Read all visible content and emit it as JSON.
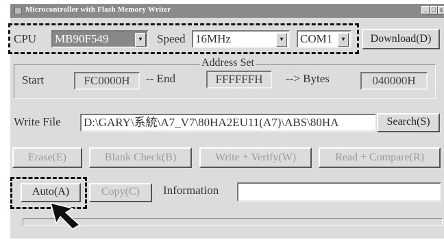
{
  "window": {
    "title": "Microcontroller with Flash Memory Writer",
    "minimize_glyph": "_",
    "maximize_glyph": "□",
    "close_glyph": "x"
  },
  "cpu": {
    "label": "CPU",
    "value": "MB90F549"
  },
  "speed": {
    "label": "Speed",
    "value": "16MHz"
  },
  "port": {
    "value": "COM1"
  },
  "download_button": "Download(D)",
  "address_set": {
    "group_title": "Address Set",
    "start_label": "Start",
    "start_value": "FC0000H",
    "end_label": "-- End",
    "end_value": "FFFFFFH",
    "bytes_label": "--> Bytes",
    "bytes_value": "040000H"
  },
  "write_file": {
    "label": "Write File",
    "value": "D:\\GARY\\系統\\A7_V7\\80HA2EU11(A7)\\ABS\\80HA",
    "search_button": "Search(S)"
  },
  "operations": {
    "erase": "Erase(E)",
    "blank_check": "Blank Check(B)",
    "write_verify": "Write + Verify(W)",
    "read_compare": "Read + Compare(R)"
  },
  "auto_button": "Auto(A)",
  "copy_button": "Copy(C)",
  "information": {
    "label": "Information",
    "value": ""
  },
  "progress": {
    "fraction": 0
  },
  "icons": {
    "pointer": "arrow-cursor-icon",
    "dropdown": "chevron-down-icon"
  },
  "colors": {
    "titlebar": "#8a8a8a",
    "window_bg": "#dcdcdc",
    "highlight_border": "#111111"
  }
}
